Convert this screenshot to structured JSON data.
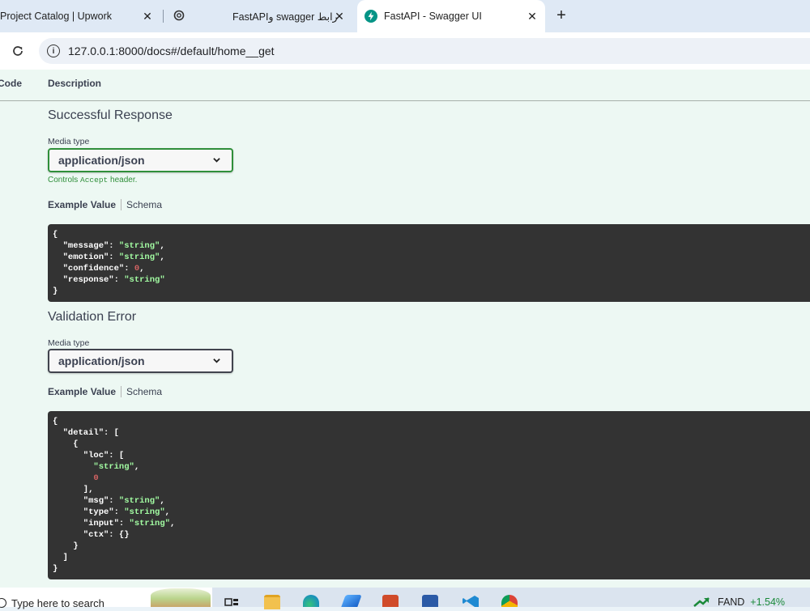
{
  "browser": {
    "tabs": [
      {
        "title": "Project Catalog | Upwork",
        "active": false
      },
      {
        "title": "",
        "icon": "chatgpt-icon",
        "active": false
      },
      {
        "title": "FastAPIو swagger رابط",
        "active": false
      },
      {
        "title": "FastAPI - Swagger UI",
        "icon": "fastapi-icon",
        "active": true
      }
    ],
    "close_glyph": "✕",
    "new_tab_glyph": "+",
    "address": "127.0.0.1:8000/docs#/default/home__get"
  },
  "responses_table": {
    "code_header": "Code",
    "description_header": "Description"
  },
  "responses": [
    {
      "title": "Successful Response",
      "media_type_label": "Media type",
      "media_type": "application/json",
      "hint_prefix": "Controls ",
      "hint_code": "Accept",
      "hint_suffix": " header.",
      "example_tab": "Example Value",
      "schema_tab": "Schema"
    },
    {
      "title": "Validation Error",
      "media_type_label": "Media type",
      "media_type": "application/json",
      "example_tab": "Example Value",
      "schema_tab": "Schema"
    }
  ],
  "taskbar": {
    "search_placeholder": "Type here to search",
    "ticker_symbol": "FAND",
    "ticker_change": "+1.54%",
    "apps": [
      "task-view-icon",
      "file-explorer-icon",
      "edge-icon",
      "azure-icon",
      "powerpoint-icon",
      "word-icon",
      "vscode-icon",
      "chrome-icon"
    ]
  },
  "colors": {
    "success_green": "#2f8f3a",
    "code_bg": "#333333",
    "string_green": "#a2fca2",
    "number_red": "#d36363"
  }
}
